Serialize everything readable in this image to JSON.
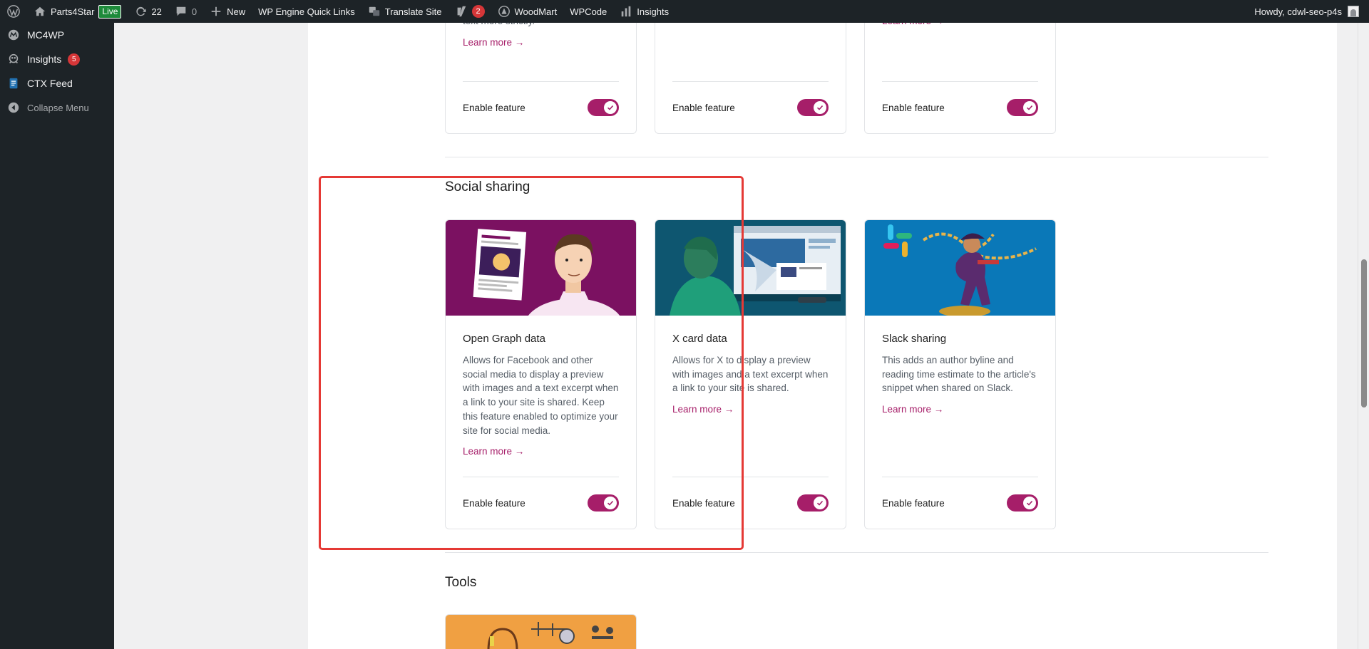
{
  "adminbar": {
    "site_name": "Parts4Star",
    "live_badge": "Live",
    "updates_count": "22",
    "comments_count": "0",
    "new_label": "New",
    "wp_engine": "WP Engine Quick Links",
    "translate": "Translate Site",
    "yoast_count": "2",
    "woodmart": "WoodMart",
    "wpcode": "WPCode",
    "insights": "Insights",
    "howdy": "Howdy, cdwl-seo-p4s"
  },
  "sidebar": {
    "items": [
      {
        "label": "MC4WP"
      },
      {
        "label": "Insights",
        "badge": "5"
      },
      {
        "label": "CTX Feed"
      },
      {
        "label": "Collapse Menu"
      }
    ]
  },
  "top_cards": [
    {
      "text_tail": "text more strictly.",
      "learn_more": "Learn more →",
      "enable": "Enable feature"
    },
    {
      "learn_more": "",
      "enable": "Enable feature"
    },
    {
      "learn_more": "Learn more →",
      "enable": "Enable feature"
    }
  ],
  "social": {
    "title": "Social sharing",
    "cards": [
      {
        "title": "Open Graph data",
        "desc": "Allows for Facebook and other social media to display a preview with images and a text excerpt when a link to your site is shared. Keep this feature enabled to optimize your site for social media.",
        "learn_more": "Learn more →",
        "enable": "Enable feature",
        "enabled": true,
        "bg": "#7b1161"
      },
      {
        "title": "X card data",
        "desc": "Allows for X to display a preview with images and a text excerpt when a link to your site is shared.",
        "learn_more": "Learn more →",
        "enable": "Enable feature",
        "enabled": true,
        "bg": "#0e5670"
      },
      {
        "title": "Slack sharing",
        "desc": "This adds an author byline and reading time estimate to the article's snippet when shared on Slack.",
        "learn_more": "Learn more →",
        "enable": "Enable feature",
        "enabled": true,
        "bg": "#0a78b8"
      }
    ]
  },
  "tools": {
    "title": "Tools"
  },
  "colors": {
    "accent": "#a61e69",
    "highlight": "#e53935"
  }
}
